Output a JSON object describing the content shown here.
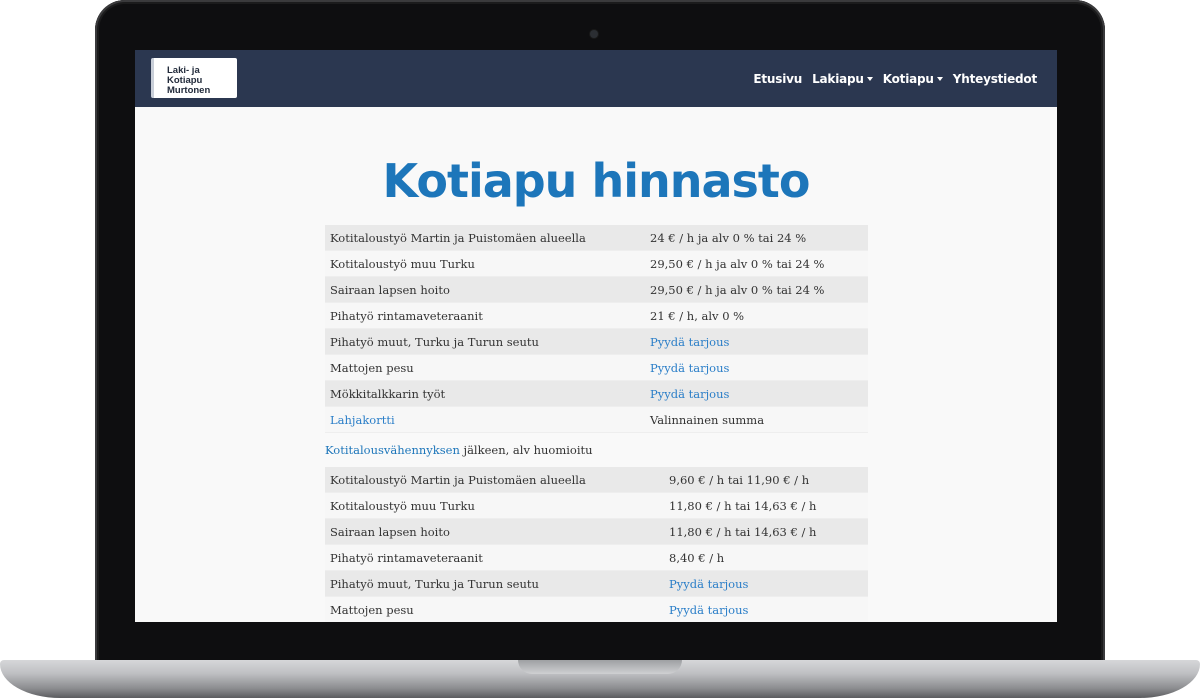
{
  "site": {
    "logo_line1": "Laki- ja Kotiapu",
    "logo_line2": "Murtonen",
    "nav": [
      {
        "label": "Etusivu",
        "dropdown": false
      },
      {
        "label": "Lakiapu",
        "dropdown": true
      },
      {
        "label": "Kotiapu",
        "dropdown": true
      },
      {
        "label": "Yhteystiedot",
        "dropdown": false
      }
    ]
  },
  "page_title": "Kotiapu hinnasto",
  "prices_table": [
    {
      "service": "Kotitaloustyö Martin ja Puistomäen alueella",
      "price": "24 € / h ja alv 0 % tai 24 %"
    },
    {
      "service": "Kotitaloustyö muu Turku",
      "price": "29,50 € / h ja alv 0 % tai 24 %"
    },
    {
      "service": "Sairaan lapsen hoito",
      "price": "29,50 € / h ja alv 0 % tai 24 %"
    },
    {
      "service": "Pihatyö rintamaveteraanit",
      "price": "21 € / h, alv 0 %"
    },
    {
      "service": "Pihatyö muut, Turku ja Turun seutu",
      "price": "Pyydä tarjous"
    },
    {
      "service": "Mattojen pesu",
      "price": "Pyydä tarjous"
    },
    {
      "service": "Mökkitalkkarin työt",
      "price": "Pyydä tarjous"
    },
    {
      "service": "Lahjakortti",
      "price": "Valinnainen summa"
    }
  ],
  "deduction_note": {
    "link_text": "Kotitalousvähennyksen",
    "text": " jälkeen, alv huomioitu"
  },
  "deduction_table": [
    {
      "service": "Kotitaloustyö Martin ja Puistomäen alueella",
      "price": "9,60 € / h tai 11,90 € / h"
    },
    {
      "service": "Kotitaloustyö muu Turku",
      "price": "11,80 € / h tai 14,63 € / h"
    },
    {
      "service": "Sairaan lapsen hoito",
      "price": "11,80 € / h tai 14,63 € / h"
    },
    {
      "service": "Pihatyö rintamaveteraanit",
      "price": "8,40 € / h"
    },
    {
      "service": "Pihatyö muut, Turku ja Turun seutu",
      "price": "Pyydä tarjous"
    },
    {
      "service": "Mattojen pesu",
      "price": "Pyydä tarjous"
    }
  ],
  "colors": {
    "navbar": "#2b3750",
    "title": "#1d76ba",
    "link": "#2a7ec8"
  }
}
